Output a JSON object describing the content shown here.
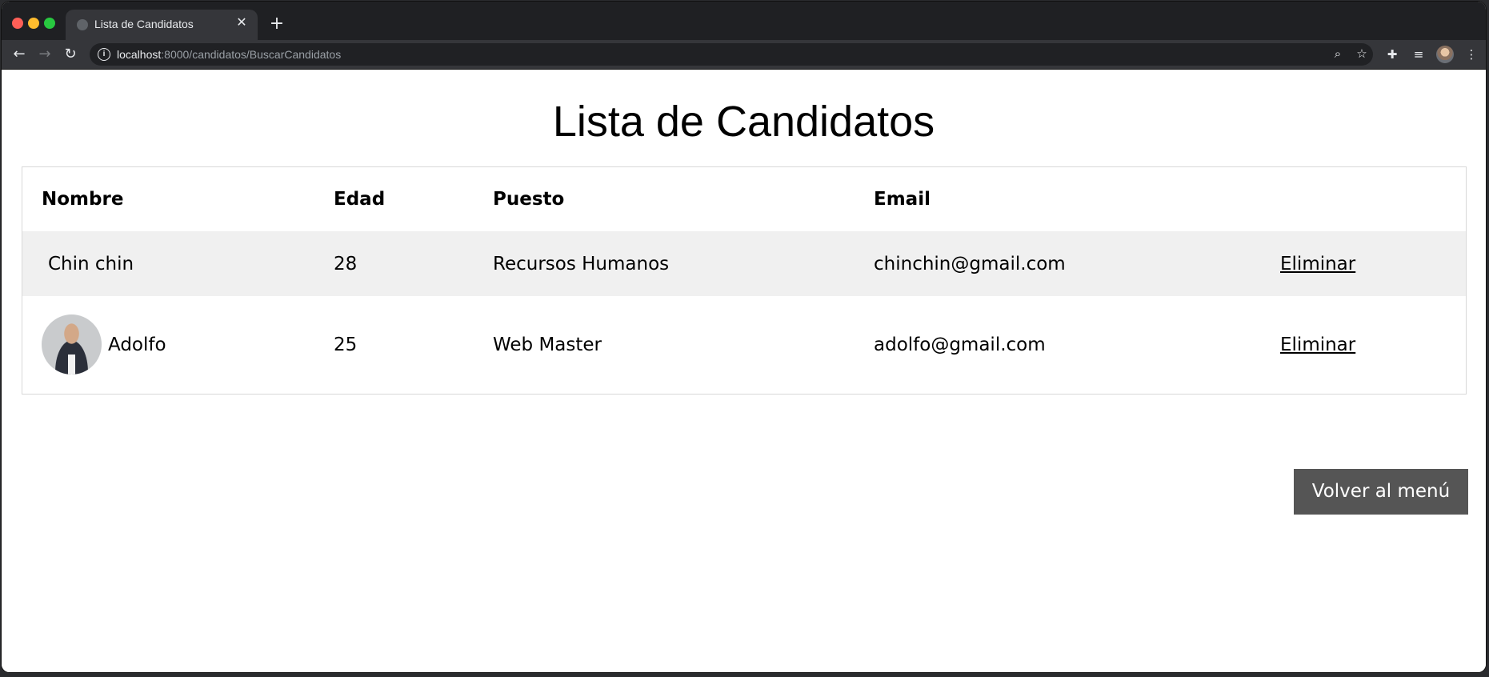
{
  "browser": {
    "tab_title": "Lista de Candidatos",
    "tab_close": "✕",
    "new_tab": "+",
    "url_host": "localhost",
    "url_path": ":8000/candidatos/BuscarCandidatos"
  },
  "page": {
    "title": "Lista de Candidatos",
    "back_button": "Volver al menú"
  },
  "table": {
    "headers": [
      "Nombre",
      "Edad",
      "Puesto",
      "Email",
      ""
    ],
    "rows": [
      {
        "name": "Chin chin",
        "age": "28",
        "position": "Recursos Humanos",
        "email": "chinchin@gmail.com",
        "action": "Eliminar",
        "has_photo": false
      },
      {
        "name": "Adolfo",
        "age": "25",
        "position": "Web Master",
        "email": "adolfo@gmail.com",
        "action": "Eliminar",
        "has_photo": true
      }
    ]
  },
  "icons": {
    "back": "arrow-left-icon",
    "forward": "arrow-right-icon",
    "reload": "reload-icon",
    "info": "info-icon",
    "zoom": "zoom-icon",
    "bookmark": "star-icon",
    "extensions": "puzzle-icon",
    "media": "media-queue-icon",
    "profile": "profile-avatar-icon",
    "menu": "kebab-menu-icon"
  },
  "colors": {
    "row_stripe": "#f0f0f0",
    "button_bg": "#555555",
    "chrome_dark": "#35363a"
  }
}
